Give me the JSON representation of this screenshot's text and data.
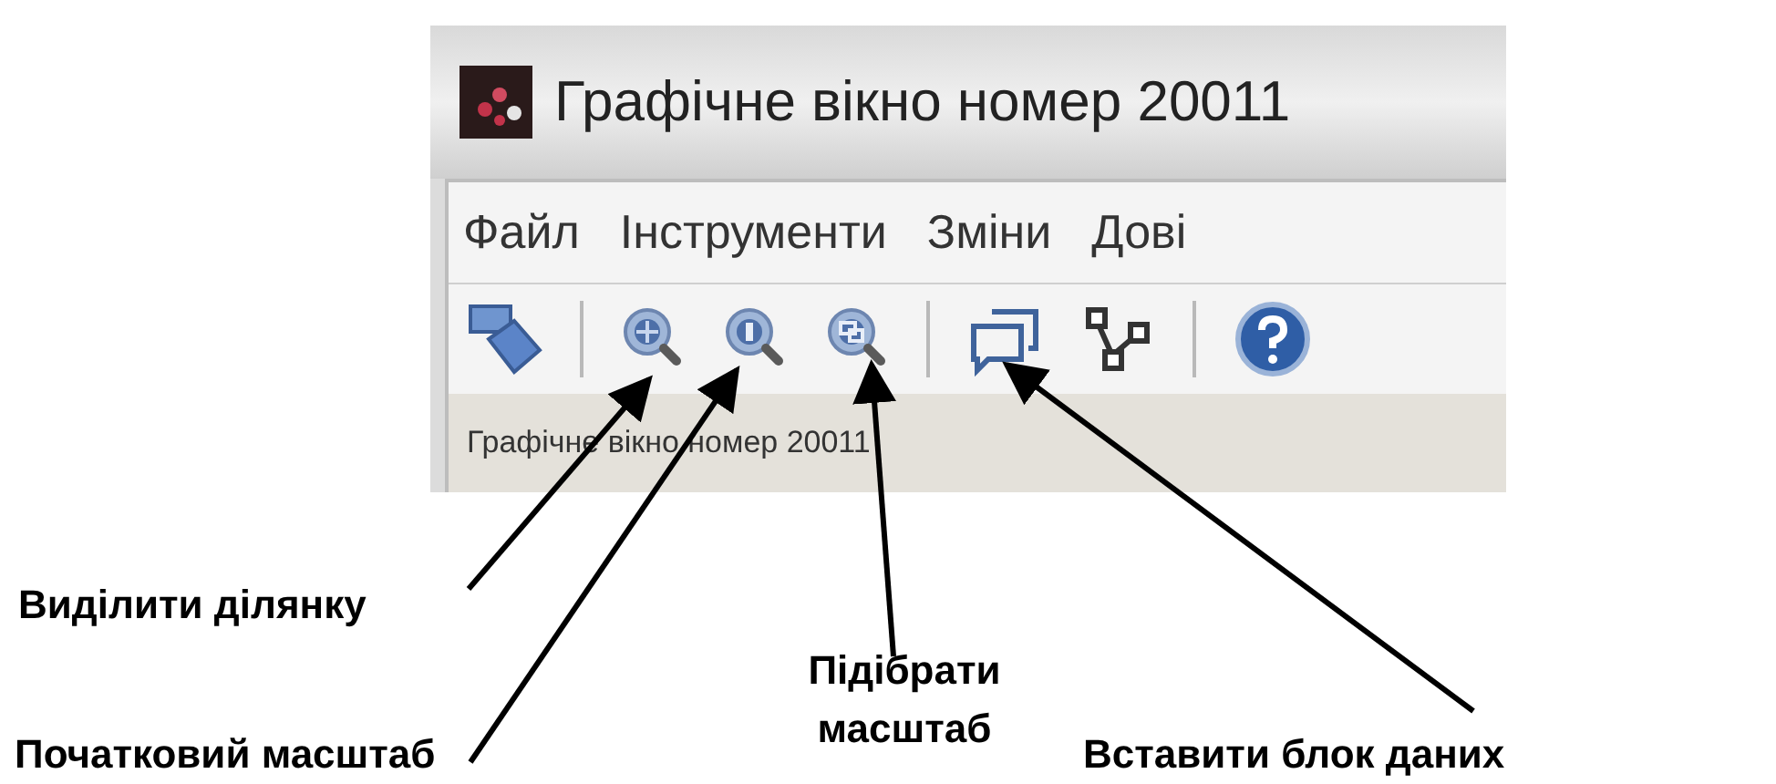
{
  "window": {
    "title": "Графічне вікно номер 20011"
  },
  "menu": [
    "Файл",
    "Інструменти",
    "Зміни",
    "Дові"
  ],
  "toolbar": [
    {
      "kind": "pointer"
    },
    {
      "kind": "separator"
    },
    {
      "kind": "zoom-area"
    },
    {
      "kind": "zoom-initial"
    },
    {
      "kind": "zoom-fit"
    },
    {
      "kind": "separator"
    },
    {
      "kind": "insert-block"
    },
    {
      "kind": "tree"
    },
    {
      "kind": "separator"
    },
    {
      "kind": "help"
    }
  ],
  "status_bar": "Графічне вікно номер 20011",
  "callouts": [
    {
      "label": "Виділити ділянку"
    },
    {
      "label": "Початковий масштаб"
    },
    {
      "label": "Підібрати масштаб"
    },
    {
      "label": "Вставити блок даних"
    }
  ]
}
